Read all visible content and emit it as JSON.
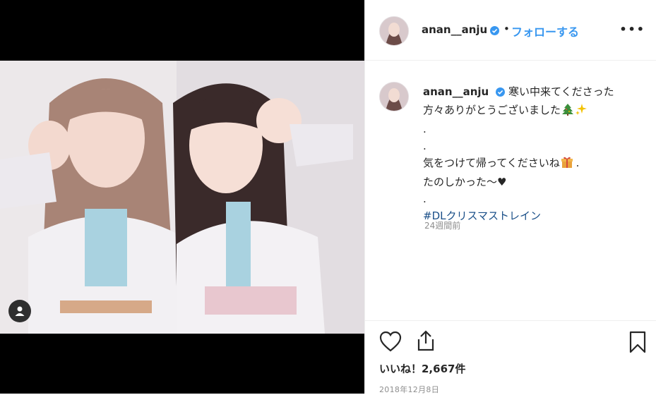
{
  "post": {
    "username": "anan__anju",
    "follow_label": "フォローする",
    "separator": "•",
    "more_label": "•••"
  },
  "caption": {
    "username": "anan__anju",
    "line1": "寒い中来てくださった",
    "line2": "方々ありがとうございました",
    "line3": ".",
    "line4": ".",
    "line5": "気をつけて帰ってくださいね",
    "line5_suffix": " .",
    "line6": "たのしかった〜♥",
    "line7": ".",
    "hashtag": "#DLクリスマストレイン",
    "emojis": [
      "christmas-tree",
      "sparkles",
      "gift"
    ]
  },
  "time_ago": "24週間前",
  "likes": {
    "label": "いいね！2,667件"
  },
  "date": "2018年12月8日",
  "icons": {
    "verified": "verified-badge-icon",
    "like": "heart-icon",
    "share": "share-icon",
    "save": "bookmark-icon",
    "user_tag": "user-icon"
  },
  "colors": {
    "link": "#3897f0",
    "hashtag": "#1a4f88",
    "muted": "#8e8e8e",
    "text": "#262626"
  }
}
